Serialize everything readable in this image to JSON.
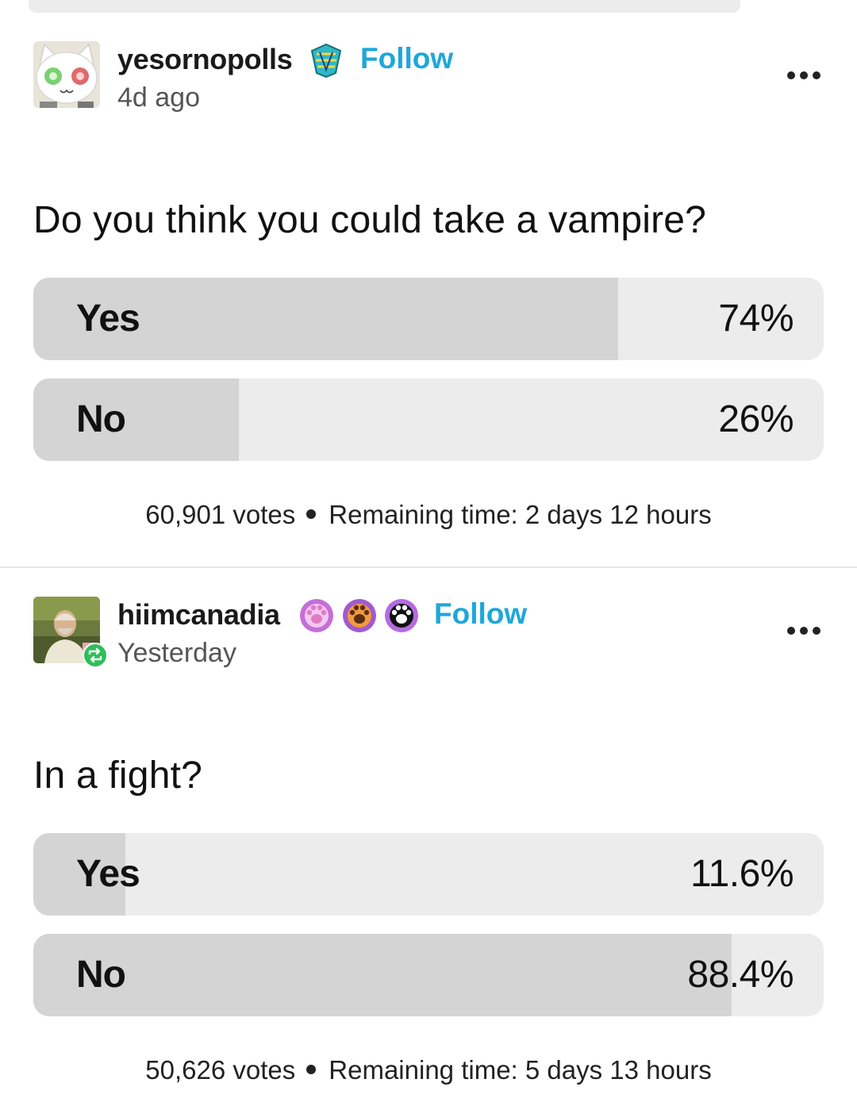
{
  "posts": [
    {
      "username": "yesornopolls",
      "follow_label": "Follow",
      "time_ago": "4d ago",
      "question": "Do you think you could take a vampire?",
      "options": [
        {
          "label": "Yes",
          "percent": "74%",
          "fill": 0.74
        },
        {
          "label": "No",
          "percent": "26%",
          "fill": 0.26
        }
      ],
      "votes": "60,901 votes",
      "remaining": "Remaining time: 2 days 12 hours",
      "avatar_icon": "white-cat-avatar",
      "badges": [
        "blue-jewel-badge"
      ]
    },
    {
      "username": "hiimcanadia",
      "follow_label": "Follow",
      "time_ago": "Yesterday",
      "question": "In a fight?",
      "options": [
        {
          "label": "Yes",
          "percent": "11.6%",
          "fill": 0.116
        },
        {
          "label": "No",
          "percent": "88.4%",
          "fill": 0.884
        }
      ],
      "votes": "50,626 votes",
      "remaining": "Remaining time: 5 days 13 hours",
      "avatar_icon": "photo-avatar",
      "reblog_icon": "reblog-icon",
      "badges": [
        "pink-paw-badge",
        "orange-paw-badge",
        "black-paw-badge"
      ]
    }
  ],
  "colors": {
    "follow": "#1fa7d8",
    "option_track": "#ececec",
    "option_fill": "#d4d4d4",
    "reblog": "#2fbe5a"
  }
}
